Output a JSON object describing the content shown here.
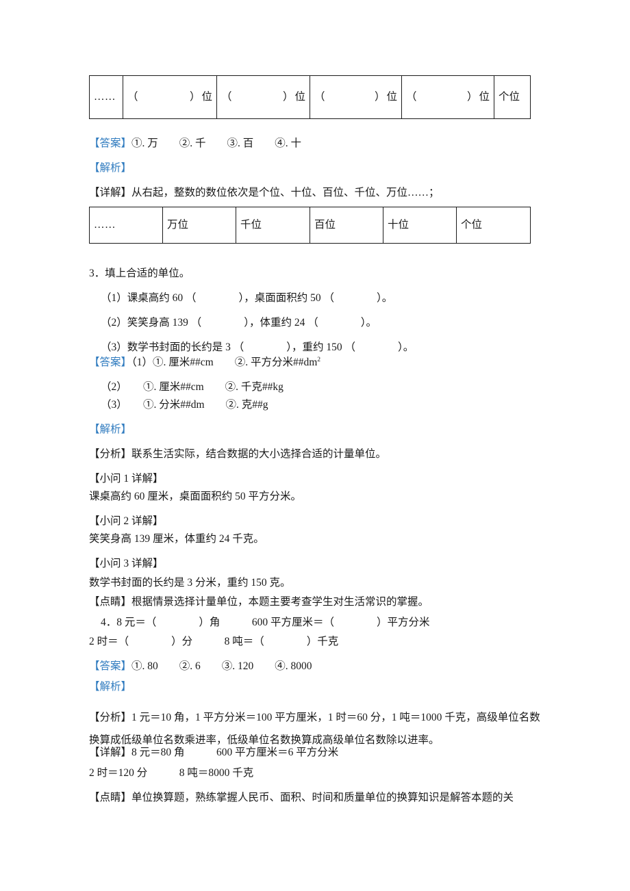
{
  "document": {
    "type": "math-exam-answer-key",
    "language": "zh-CN"
  },
  "table1": {
    "name": "place-value-blank-table",
    "cells": [
      {
        "kind": "dots",
        "text": "……"
      },
      {
        "kind": "paren",
        "left": "（",
        "right": "）",
        "suffix": "位"
      },
      {
        "kind": "paren",
        "left": "（",
        "right": "）",
        "suffix": "位"
      },
      {
        "kind": "paren",
        "left": "（",
        "right": "）",
        "suffix": "位"
      },
      {
        "kind": "paren",
        "left": "（",
        "right": "）",
        "suffix": "位"
      },
      {
        "kind": "plain",
        "text": "个位"
      }
    ]
  },
  "table2": {
    "name": "place-value-filled-table",
    "cells": [
      {
        "kind": "dots",
        "text": "……"
      },
      {
        "kind": "plain",
        "text": "万位"
      },
      {
        "kind": "plain",
        "text": "千位"
      },
      {
        "kind": "plain",
        "text": "百位"
      },
      {
        "kind": "plain",
        "text": "十位"
      },
      {
        "kind": "plain",
        "text": "个位"
      }
    ]
  },
  "q2": {
    "answer_label": "【答案】",
    "answer_text": "①. 万　　②. 千　　③. 百　　④. 十",
    "analysis_label": "【解析】",
    "detail_line": "【详解】从右起，整数的数位依次是个位、十位、百位、千位、万位……；"
  },
  "q3": {
    "stem": "3．填上合适的单位。",
    "sub1": "（1）课桌高约 60 （　　　　），桌面面积约 50 （　　　　）。",
    "sub2": "（2）笑笑身高 139 （　　　　），体重约 24 （　　　　）。",
    "sub3": "（3）数学书封面的长约是 3 （　　　　），重约 150 （　　　　）。",
    "answer_label": "【答案】",
    "answer_l1_prefix": "（1）",
    "answer_l1": "①. 厘米##cm　　②. 平方分米##dm",
    "answer_l1_sup": "2",
    "answer_l2": "（2）　　①. 厘米##cm　　②. 千克##kg",
    "answer_l3": "（3）　　①. 分米##dm　　②. 克##g",
    "analysis_label": "【解析】",
    "analysis": "【分析】联系生活实际，结合数据的大小选择合适的计量单位。",
    "sub1_head": "【小问 1 详解】",
    "sub1_body": "课桌高约 60 厘米，桌面面积约 50 平方分米。",
    "sub2_head": "【小问 2 详解】",
    "sub2_body": "笑笑身高 139 厘米，体重约 24 千克。",
    "sub3_head": "【小问 3 详解】",
    "sub3_body": "数学书封面的长约是 3 分米，重约 150 克。",
    "key_point": "【点睛】根据情景选择计量单位，本题主要考查学生对生活常识的掌握。"
  },
  "q4": {
    "stem_line1": "4．8 元＝（　　　　）角　　　600 平方厘米＝（　　　　）平方分米",
    "stem_line2": "2 时＝（　　　　）分　　　8 吨＝（　　　　）千克",
    "answer_label": "【答案】",
    "answer_text": "①. 80　　②. 6　　③. 120　　④. 8000",
    "analysis_label": "【解析】",
    "analysis": "【分析】1 元＝10 角，1 平方分米＝100 平方厘米，1 时＝60 分，1 吨＝1000 千克，高级单位名数换算成低级单位名数乘进率，低级单位名数换算成高级单位名数除以进率。",
    "detail_line1": "【详解】8 元＝80 角　　　600 平方厘米＝6 平方分米",
    "detail_line2": "2 时＝120 分　　　8 吨＝8000 千克",
    "key_point": "【点睛】单位换算题，熟练掌握人民币、面积、时间和质量单位的换算知识是解答本题的关"
  },
  "colors": {
    "label_blue": "#2f7bbf",
    "text_black": "#1a1a1a",
    "border": "#1a1a1a",
    "background": "#ffffff"
  }
}
